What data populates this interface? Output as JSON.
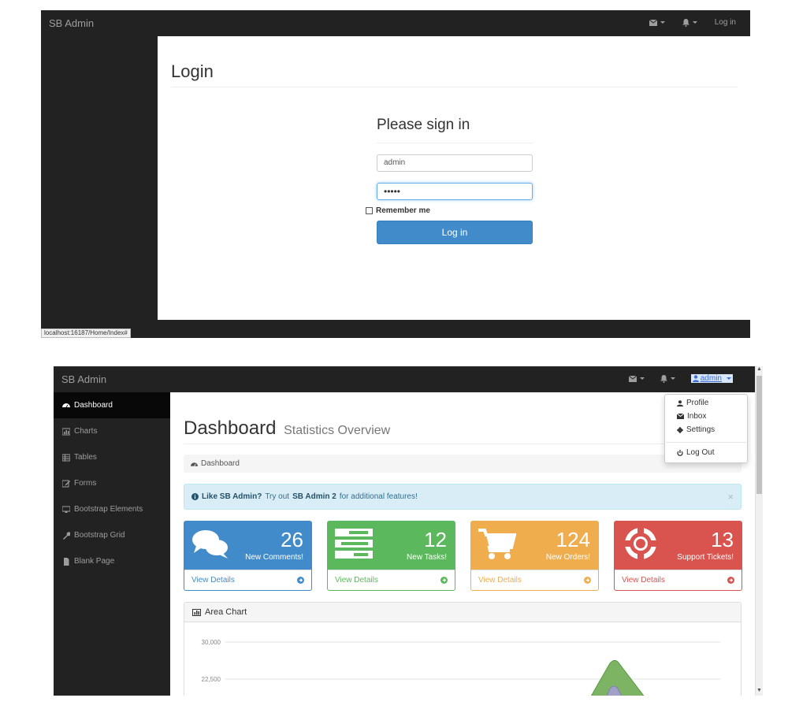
{
  "login_screen": {
    "brand": "SB Admin",
    "nav": {
      "login_link": "Log in"
    },
    "page_title": "Login",
    "form": {
      "title": "Please sign in",
      "username_value": "admin",
      "password_value": "•••••",
      "remember_label": "Remember me",
      "submit_label": "Log in"
    },
    "status_url": "localhost:16187/Home/Index#"
  },
  "dashboard_screen": {
    "brand": "SB Admin",
    "nav": {
      "user_label": "admin"
    },
    "user_dropdown": [
      {
        "label": "Profile",
        "icon": "user-icon"
      },
      {
        "label": "Inbox",
        "icon": "envelope-icon"
      },
      {
        "label": "Settings",
        "icon": "gear-icon"
      },
      {
        "label": "Log Out",
        "icon": "power-icon"
      }
    ],
    "sidebar": [
      {
        "label": "Dashboard",
        "icon": "dashboard-icon",
        "active": true
      },
      {
        "label": "Charts",
        "icon": "bar-chart-icon",
        "active": false
      },
      {
        "label": "Tables",
        "icon": "table-icon",
        "active": false
      },
      {
        "label": "Forms",
        "icon": "edit-icon",
        "active": false
      },
      {
        "label": "Bootstrap Elements",
        "icon": "desktop-icon",
        "active": false
      },
      {
        "label": "Bootstrap Grid",
        "icon": "wrench-icon",
        "active": false
      },
      {
        "label": "Blank Page",
        "icon": "file-icon",
        "active": false
      }
    ],
    "heading": {
      "title": "Dashboard",
      "subtitle": "Statistics Overview"
    },
    "breadcrumb": "Dashboard",
    "alert": {
      "strong": "Like SB Admin?",
      "text1": "Try out",
      "link": "SB Admin 2",
      "text2": "for additional features!",
      "close": "×"
    },
    "panels": [
      {
        "value": "26",
        "label": "New Comments!",
        "link": "View Details",
        "color": "#428bca",
        "icon": "comments-icon"
      },
      {
        "value": "12",
        "label": "New Tasks!",
        "link": "View Details",
        "color": "#5cb85c",
        "icon": "tasks-icon"
      },
      {
        "value": "124",
        "label": "New Orders!",
        "link": "View Details",
        "color": "#f0ad4e",
        "icon": "shopping-cart-icon"
      },
      {
        "value": "13",
        "label": "Support Tickets!",
        "link": "View Details",
        "color": "#d9534f",
        "icon": "support-icon"
      }
    ],
    "area_chart": {
      "title": "Area Chart",
      "chart_data": {
        "type": "area",
        "y_ticks": [
          "30,000",
          "22,500"
        ],
        "series_colors": [
          "#7cb463",
          "#a0a0c8"
        ]
      }
    }
  }
}
